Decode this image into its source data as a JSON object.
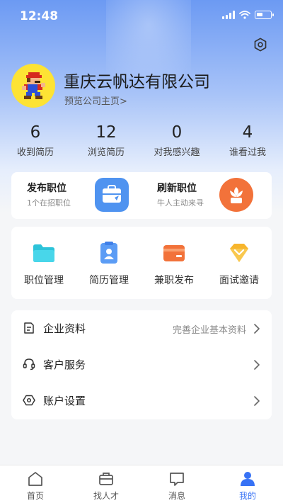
{
  "status_bar": {
    "time": "12:48"
  },
  "profile": {
    "company_name": "重庆云帆达有限公司",
    "preview_link": "预览公司主页>"
  },
  "stats": [
    {
      "value": "6",
      "label": "收到简历"
    },
    {
      "value": "12",
      "label": "浏览简历"
    },
    {
      "value": "0",
      "label": "对我感兴趣"
    },
    {
      "value": "4",
      "label": "谁看过我"
    }
  ],
  "promo": [
    {
      "title": "发布职位",
      "subtitle": "1个在招职位",
      "icon": "briefcase-icon"
    },
    {
      "title": "刷新职位",
      "subtitle": "牛人主动来寻",
      "icon": "flower-icon"
    }
  ],
  "tools": [
    {
      "label": "职位管理",
      "icon": "folder-icon"
    },
    {
      "label": "简历管理",
      "icon": "resume-icon"
    },
    {
      "label": "兼职发布",
      "icon": "card-icon"
    },
    {
      "label": "面试邀请",
      "icon": "diamond-icon"
    }
  ],
  "menu": [
    {
      "label": "企业资料",
      "value": "完善企业基本资料",
      "icon": "document-icon"
    },
    {
      "label": "客户服务",
      "value": "",
      "icon": "headset-icon"
    },
    {
      "label": "账户设置",
      "value": "",
      "icon": "hexagon-settings-icon"
    }
  ],
  "tabbar": [
    {
      "label": "首页",
      "icon": "home-icon",
      "active": false
    },
    {
      "label": "找人才",
      "icon": "briefcase-icon",
      "active": false
    },
    {
      "label": "消息",
      "icon": "message-icon",
      "active": false
    },
    {
      "label": "我的",
      "icon": "person-icon",
      "active": true
    }
  ],
  "colors": {
    "accent": "#3772f5",
    "header_gradient_top": "#6c9af3",
    "avatar_bg": "#fde334",
    "promo_blue": "#4f93f0",
    "promo_orange": "#f2723a"
  }
}
